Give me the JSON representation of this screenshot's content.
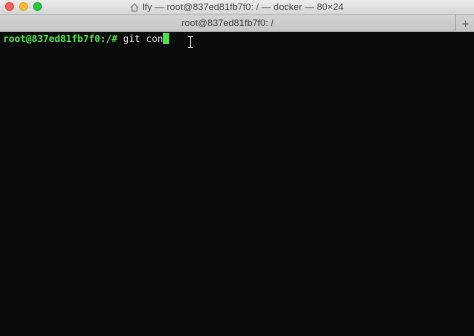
{
  "window": {
    "title": "lfy — root@837ed81fb7f0: / — docker — 80×24",
    "title_icon": "home-icon",
    "colors": {
      "background": "#0b0b0b",
      "prompt": "#49e64a",
      "text": "#e8e8e8"
    }
  },
  "tabs": [
    {
      "label": "root@837ed81fb7f0: /"
    }
  ],
  "new_tab_label": "+",
  "terminal": {
    "prompt": "root@837ed81fb7f0:/#",
    "command": " git con"
  }
}
